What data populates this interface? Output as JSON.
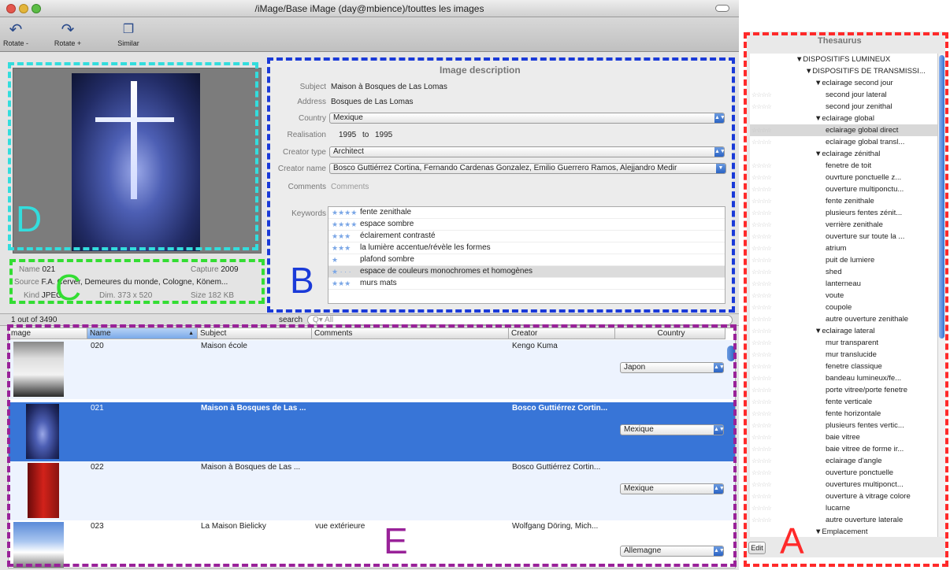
{
  "window": {
    "title": "/iMage/Base iMage (day@mbience)/touttes les images"
  },
  "toolbar": {
    "rotate_minus": "Rotate -",
    "rotate_plus": "Rotate +",
    "similar": "Similar"
  },
  "info": {
    "name_label": "Name",
    "name_value": "021",
    "capture_label": "Capture",
    "capture_value": "2009",
    "source_label": "Source",
    "source_value": "F.A. Cerver, Demeures du monde, Cologne, Könem...",
    "kind_label": "Kind",
    "kind_value": "JPEG",
    "dim_label": "Dim.",
    "dim_value": "373 x 520",
    "size_label": "Size",
    "size_value": "182 KB"
  },
  "description": {
    "header": "Image description",
    "subject_label": "Subject",
    "subject_value": "Maison à Bosques de Las Lomas",
    "address_label": "Address",
    "address_value": "Bosques de Las Lomas",
    "country_label": "Country",
    "country_value": "Mexique",
    "realisation_label": "Realisation",
    "realisation_from": "1995",
    "realisation_to_label": "to",
    "realisation_to": "1995",
    "creator_type_label": "Creator type",
    "creator_type_value": "Architect",
    "creator_name_label": "Creator name",
    "creator_name_value": "Bosco Guttiérrez Cortina, Fernando Cardenas Gonzalez, Emilio Guerrero Ramos, Alejjandro Medir",
    "comments_label": "Comments",
    "comments_placeholder": "Comments",
    "keywords_label": "Keywords",
    "keywords": [
      {
        "stars": "★★★★",
        "text": "fente zenithale"
      },
      {
        "stars": "★★★★",
        "text": "espace sombre"
      },
      {
        "stars": "★★★",
        "text": "éclairement contrasté"
      },
      {
        "stars": "★★★",
        "text": "la lumière accentue/révèle les formes"
      },
      {
        "stars": "★",
        "text": "plafond sombre"
      },
      {
        "stars": "★ · · ·",
        "text": "espace de couleurs monochromes et homogènes"
      },
      {
        "stars": "★★★",
        "text": "murs mats"
      }
    ]
  },
  "search": {
    "count": "1 out of 3490",
    "label": "search",
    "placeholder": "Q▾ All"
  },
  "table": {
    "columns": [
      "mage",
      "Name",
      "Subject",
      "Comments",
      "Creator",
      "Country"
    ],
    "rows": [
      {
        "name": "020",
        "subject": "Maison école",
        "comments": "",
        "creator": "Kengo Kuma",
        "country": "Japon"
      },
      {
        "name": "021",
        "subject": "Maison à Bosques de Las ...",
        "comments": "",
        "creator": "Bosco Guttiérrez Cortin...",
        "country": "Mexique"
      },
      {
        "name": "022",
        "subject": "Maison à Bosques de Las ...",
        "comments": "",
        "creator": "Bosco Guttiérrez Cortin...",
        "country": "Mexique"
      },
      {
        "name": "023",
        "subject": "La Maison Bielicky",
        "comments": "vue extérieure",
        "creator": "Wolfgang Döring, Mich...",
        "country": "Allemagne"
      }
    ]
  },
  "thesaurus": {
    "title": "Thesaurus",
    "edit": "Edit",
    "items": [
      {
        "text": "▼DISPOSITIFS LUMINEUX",
        "level": 0,
        "stars": ""
      },
      {
        "text": "▼DISPOSITIFS DE TRANSMISSI...",
        "level": 1,
        "stars": ""
      },
      {
        "text": "▼eclairage second jour",
        "level": 2,
        "stars": ""
      },
      {
        "text": "second jour lateral",
        "level": 3,
        "stars": "☆☆☆☆"
      },
      {
        "text": "second jour zenithal",
        "level": 3,
        "stars": "☆☆☆☆"
      },
      {
        "text": "▼eclairage global",
        "level": 2,
        "stars": ""
      },
      {
        "text": "eclairage global direct",
        "level": 3,
        "stars": "☆☆☆☆"
      },
      {
        "text": "eclairage global transl...",
        "level": 3,
        "stars": "☆☆☆☆"
      },
      {
        "text": "▼eclairage zénithal",
        "level": 2,
        "stars": ""
      },
      {
        "text": "fenetre de toit",
        "level": 3,
        "stars": "☆☆☆☆"
      },
      {
        "text": "ouvrture ponctuelle z...",
        "level": 3,
        "stars": "☆☆☆☆"
      },
      {
        "text": "ouverture multiponctu...",
        "level": 3,
        "stars": "☆☆☆☆"
      },
      {
        "text": "fente zenithale",
        "level": 3,
        "stars": "☆☆☆☆"
      },
      {
        "text": "plusieurs fentes zénit...",
        "level": 3,
        "stars": "☆☆☆☆"
      },
      {
        "text": "verrière zenithale",
        "level": 3,
        "stars": "☆☆☆☆"
      },
      {
        "text": "ouverture sur toute la ...",
        "level": 3,
        "stars": "☆☆☆☆"
      },
      {
        "text": "atrium",
        "level": 3,
        "stars": "☆☆☆☆"
      },
      {
        "text": "puit de lumiere",
        "level": 3,
        "stars": "☆☆☆☆"
      },
      {
        "text": "shed",
        "level": 3,
        "stars": "☆☆☆☆"
      },
      {
        "text": "lanterneau",
        "level": 3,
        "stars": "☆☆☆☆"
      },
      {
        "text": "voute",
        "level": 3,
        "stars": "☆☆☆☆"
      },
      {
        "text": "coupole",
        "level": 3,
        "stars": "☆☆☆☆"
      },
      {
        "text": "autre ouverture zenithale",
        "level": 3,
        "stars": "☆☆☆☆"
      },
      {
        "text": "▼eclairage lateral",
        "level": 2,
        "stars": "☆☆☆☆"
      },
      {
        "text": "mur transparent",
        "level": 3,
        "stars": "☆☆☆☆"
      },
      {
        "text": "mur translucide",
        "level": 3,
        "stars": "☆☆☆☆"
      },
      {
        "text": "fenetre classique",
        "level": 3,
        "stars": "☆☆☆☆"
      },
      {
        "text": "bandeau lumineux/fe...",
        "level": 3,
        "stars": "☆☆☆☆"
      },
      {
        "text": "porte vitree/porte fenetre",
        "level": 3,
        "stars": "☆☆☆☆"
      },
      {
        "text": "fente verticale",
        "level": 3,
        "stars": "☆☆☆☆"
      },
      {
        "text": "fente horizontale",
        "level": 3,
        "stars": "☆☆☆☆"
      },
      {
        "text": "plusieurs fentes vertic...",
        "level": 3,
        "stars": "☆☆☆☆"
      },
      {
        "text": "baie vitree",
        "level": 3,
        "stars": "☆☆☆☆"
      },
      {
        "text": "baie vitree de forme ir...",
        "level": 3,
        "stars": "☆☆☆☆"
      },
      {
        "text": "eclairage d'angle",
        "level": 3,
        "stars": "☆☆☆☆"
      },
      {
        "text": "ouverture ponctuelle",
        "level": 3,
        "stars": "☆☆☆☆"
      },
      {
        "text": "ouvertures multiponct...",
        "level": 3,
        "stars": "☆☆☆☆"
      },
      {
        "text": "ouverture à vitrage colore",
        "level": 3,
        "stars": "☆☆☆☆"
      },
      {
        "text": "lucarne",
        "level": 3,
        "stars": "☆☆☆☆"
      },
      {
        "text": "autre ouverture laterale",
        "level": 3,
        "stars": "☆☆☆☆"
      },
      {
        "text": "▼Emplacement",
        "level": 2,
        "stars": ""
      }
    ]
  },
  "annotations": {
    "a": "A",
    "b": "B",
    "c": "C",
    "d": "D",
    "e": "E",
    "colors": {
      "a": "#ff2a2a",
      "b": "#1a3ad8",
      "c": "#33dd33",
      "d": "#33dddd",
      "e": "#992299"
    }
  }
}
